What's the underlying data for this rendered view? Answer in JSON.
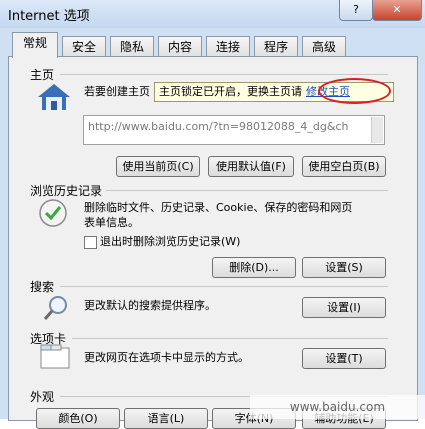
{
  "window": {
    "title": "Internet 选项",
    "help_label": "?",
    "close_label": "✕"
  },
  "tabs": [
    "常规",
    "安全",
    "隐私",
    "内容",
    "连接",
    "程序",
    "高级"
  ],
  "home": {
    "section_label": "主页",
    "intro": "若要创建主页",
    "tooltip_text": "主页锁定已开启，更换主页请",
    "tooltip_link": "修改主页",
    "url": "http://www.baidu.com/?tn=98012088_4_dg&ch",
    "btn_current": "使用当前页(C)",
    "btn_default": "使用默认值(F)",
    "btn_blank": "使用空白页(B)"
  },
  "history": {
    "section_label": "浏览历史记录",
    "desc_line1": "删除临时文件、历史记录、Cookie、保存的密码和网页",
    "desc_line2": "表单信息。",
    "checkbox_label": "退出时删除浏览历史记录(W)",
    "btn_delete": "删除(D)...",
    "btn_settings": "设置(S)"
  },
  "search": {
    "section_label": "搜索",
    "desc": "更改默认的搜索提供程序。",
    "btn_settings": "设置(I)"
  },
  "tabs_section": {
    "section_label": "选项卡",
    "desc": "更改网页在选项卡中显示的方式。",
    "btn_settings": "设置(T)"
  },
  "appearance": {
    "section_label": "外观",
    "btn_colors": "颜色(O)",
    "btn_languages": "语言(L)",
    "btn_fonts": "字体(N)",
    "btn_accessibility": "辅助功能(E)"
  },
  "watermark": "www.baidu.com"
}
